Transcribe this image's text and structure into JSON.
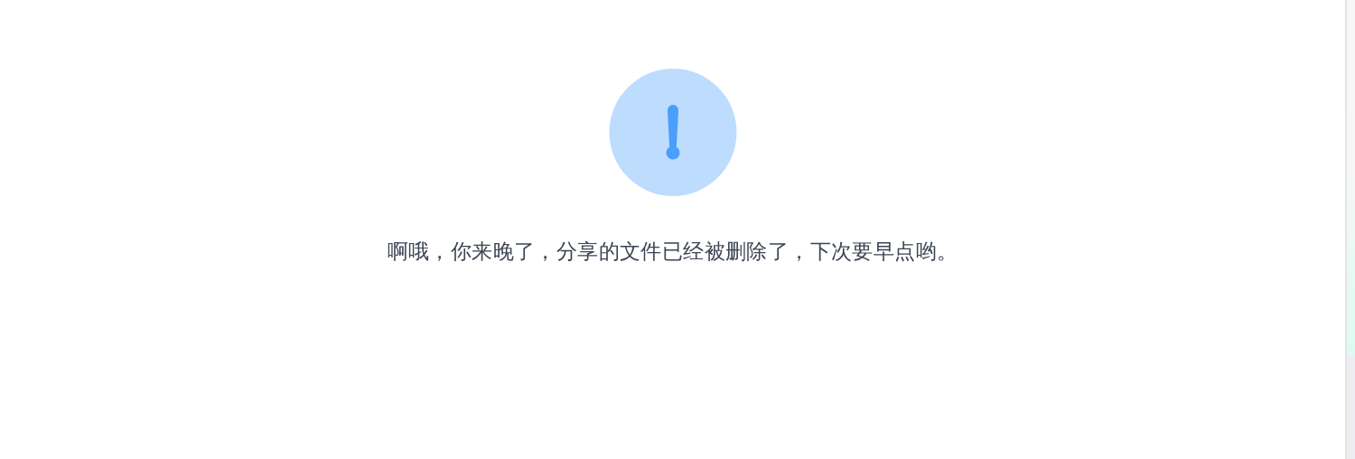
{
  "message": {
    "kind": "warning",
    "text": "啊哦，你来晚了，分享的文件已经被删除了，下次要早点哟。"
  }
}
